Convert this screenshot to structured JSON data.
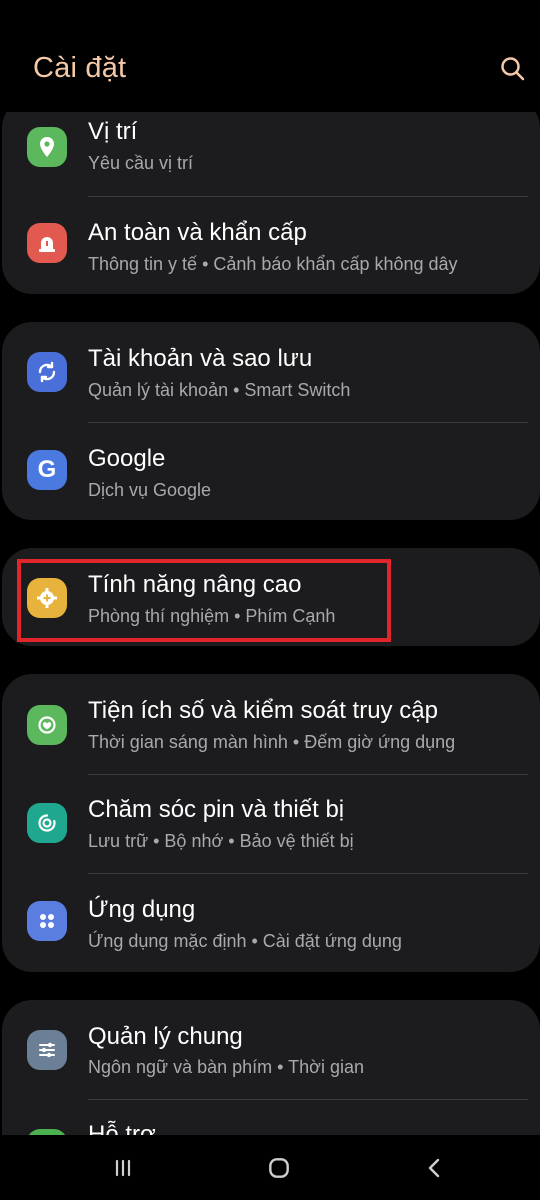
{
  "header": {
    "title": "Cài đặt"
  },
  "items": [
    {
      "title": "Vị trí",
      "subtitle": "Yêu cầu vị trí",
      "icon": "location-pin-icon",
      "color": "#5cb85c"
    },
    {
      "title": "An toàn và khẩn cấp",
      "subtitle": "Thông tin y tế  •  Cảnh báo khẩn cấp không dây",
      "icon": "emergency-siren-icon",
      "color": "#e25a4f"
    },
    {
      "title": "Tài khoản và sao lưu",
      "subtitle": "Quản lý tài khoản  •  Smart Switch",
      "icon": "sync-arrows-icon",
      "color": "#4a6fd8"
    },
    {
      "title": "Google",
      "subtitle": "Dịch vụ Google",
      "icon": "google-g-icon",
      "color": "#4a79e0"
    },
    {
      "title": "Tính năng nâng cao",
      "subtitle": "Phòng thí nghiệm  •  Phím Cạnh",
      "icon": "gear-plus-icon",
      "color": "#e8b33c"
    },
    {
      "title": "Tiện ích số và kiểm soát truy cập",
      "subtitle": "Thời gian sáng màn hình  •  Đếm giờ ứng dụng",
      "icon": "digital-wellbeing-icon",
      "color": "#5cb85c"
    },
    {
      "title": "Chăm sóc pin và thiết bị",
      "subtitle": "Lưu trữ  •  Bộ nhớ  •  Bảo vệ thiết bị",
      "icon": "device-care-icon",
      "color": "#1fa88f"
    },
    {
      "title": "Ứng dụng",
      "subtitle": "Ứng dụng mặc định  •  Cài đặt ứng dụng",
      "icon": "apps-grid-icon",
      "color": "#5b7fe0"
    },
    {
      "title": "Quản lý chung",
      "subtitle": "Ngôn ngữ và bàn phím  •  Thời gian",
      "icon": "sliders-icon",
      "color": "#6b7f96"
    },
    {
      "title": "Hỗ trợ",
      "subtitle": "",
      "icon": "accessibility-icon",
      "color": "#4caf50"
    }
  ],
  "navbar": {
    "buttons": [
      "recents",
      "home",
      "back"
    ]
  }
}
